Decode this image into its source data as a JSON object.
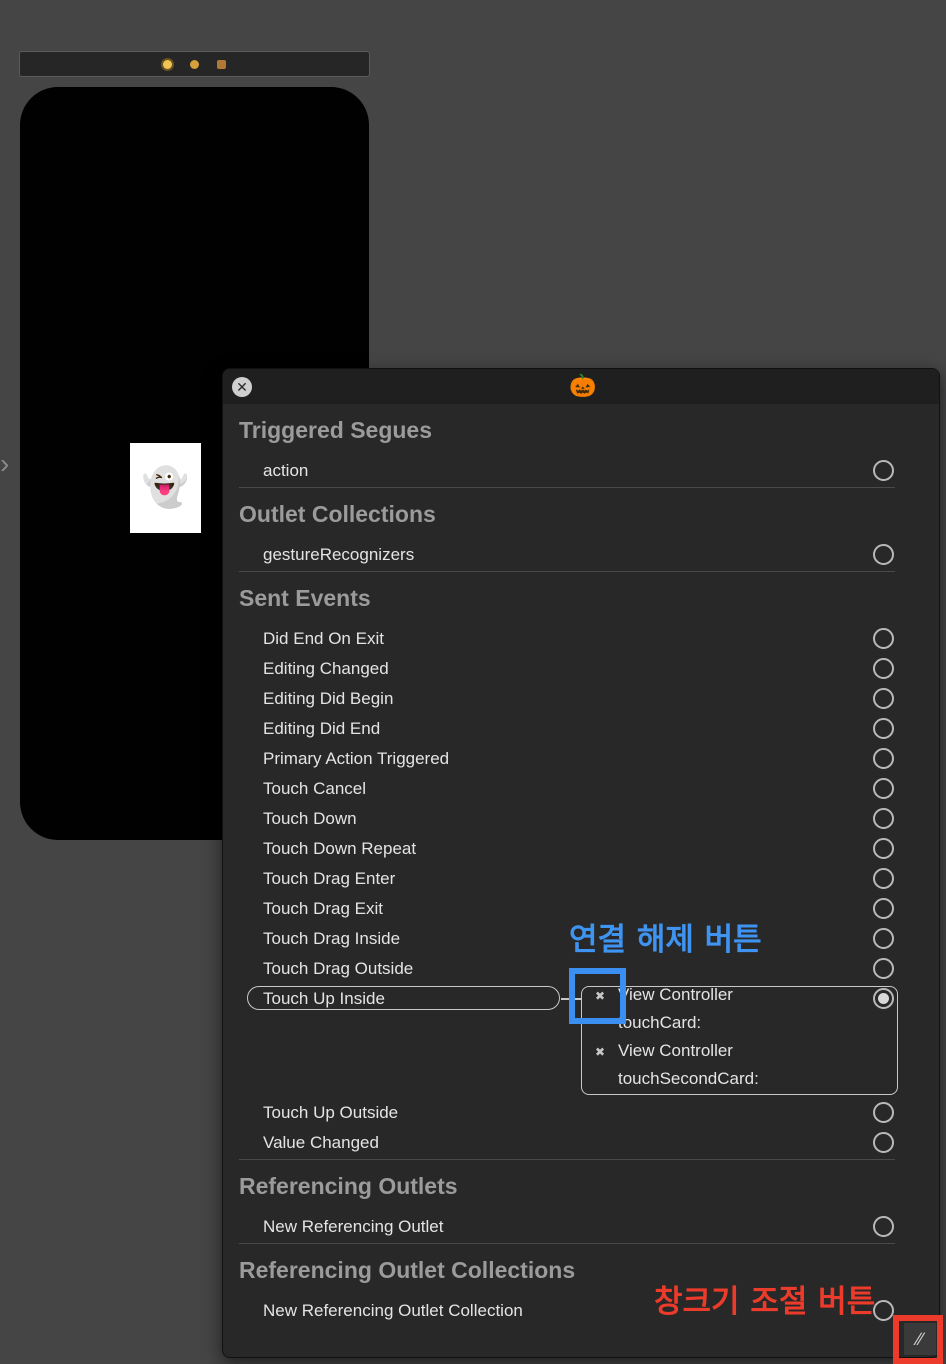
{
  "scene_dock": {
    "icons": [
      "view-controller-icon",
      "first-responder-icon",
      "exit-icon"
    ]
  },
  "canvas": {
    "card_1": {
      "emoji": "👻"
    }
  },
  "panel": {
    "close_icon": "✕",
    "title_icon": "🎃",
    "sections": {
      "triggered_segues": {
        "heading": "Triggered Segues",
        "items": [
          "action"
        ]
      },
      "outlet_collections": {
        "heading": "Outlet Collections",
        "items": [
          "gestureRecognizers"
        ]
      },
      "sent_events": {
        "heading": "Sent Events",
        "items": [
          "Did End On Exit",
          "Editing Changed",
          "Editing Did Begin",
          "Editing Did End",
          "Primary Action Triggered",
          "Touch Cancel",
          "Touch Down",
          "Touch Down Repeat",
          "Touch Drag Enter",
          "Touch Drag Exit",
          "Touch Drag Inside",
          "Touch Drag Outside",
          "Touch Up Inside",
          "Touch Up Outside",
          "Value Changed"
        ],
        "connections": [
          {
            "target": "View Controller",
            "action": "touchCard:"
          },
          {
            "target": "View Controller",
            "action": "touchSecondCard:"
          }
        ]
      },
      "referencing_outlets": {
        "heading": "Referencing Outlets",
        "items": [
          "New Referencing Outlet"
        ]
      },
      "referencing_outlet_collections": {
        "heading": "Referencing Outlet Collections",
        "items": [
          "New Referencing Outlet Collection"
        ]
      }
    }
  },
  "annotations": {
    "disconnect_label": "연결 해제 버튼",
    "resize_label": "창크기 조절 버튼",
    "blue": "#3a8ff0",
    "red": "#ec3b2a"
  }
}
